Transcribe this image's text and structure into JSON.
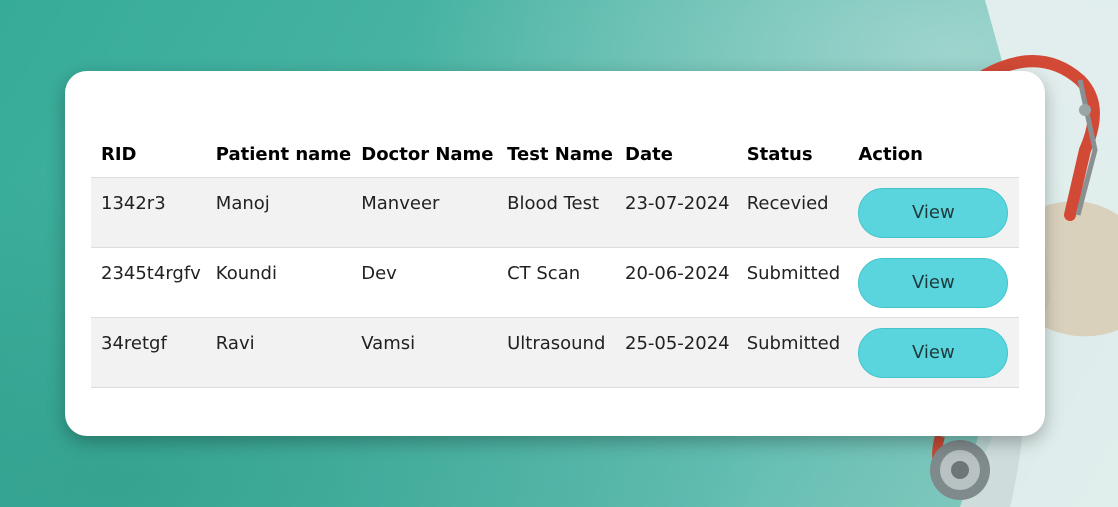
{
  "colors": {
    "background": "#4cb5a5",
    "card": "#ffffff",
    "row_stripe": "#f2f2f2",
    "button": "#5ad5dd"
  },
  "table": {
    "headers": [
      "RID",
      "Patient name",
      "Doctor Name",
      "Test Name",
      "Date",
      "Status",
      "Action"
    ],
    "rows": [
      {
        "rid": "1342r3",
        "patient": "Manoj",
        "doctor": "Manveer",
        "test": "Blood Test",
        "date": "23-07-2024",
        "status": "Recevied",
        "action": "View"
      },
      {
        "rid": "2345t4rgfv",
        "patient": "Koundi",
        "doctor": "Dev",
        "test": "CT Scan",
        "date": "20-06-2024",
        "status": "Submitted",
        "action": "View"
      },
      {
        "rid": "34retgf",
        "patient": "Ravi",
        "doctor": "Vamsi",
        "test": "Ultrasound",
        "date": "25-05-2024",
        "status": "Submitted",
        "action": "View"
      }
    ]
  },
  "background_icons": [
    "doctor-coat-icon",
    "stethoscope-icon"
  ]
}
